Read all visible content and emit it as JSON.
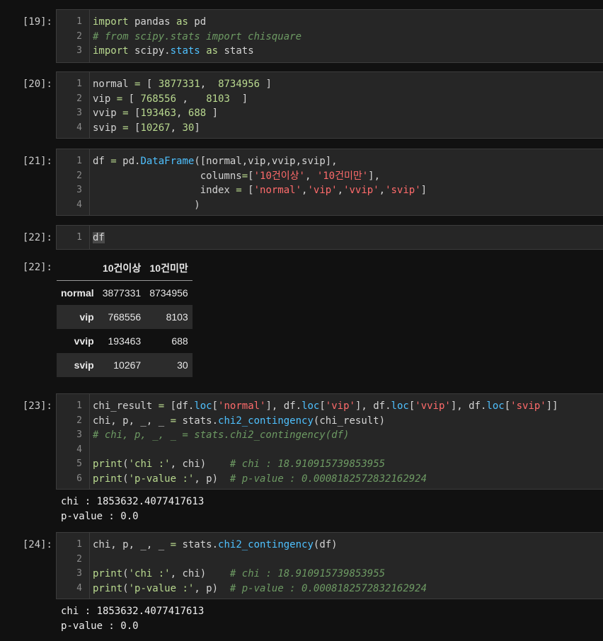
{
  "cells": [
    {
      "prompt": "[19]:",
      "line_numbers": [
        "1",
        "2",
        "3"
      ],
      "lines": [
        [
          {
            "t": "import",
            "c": "kw"
          },
          {
            "t": " pandas ",
            "c": ""
          },
          {
            "t": "as",
            "c": "kw"
          },
          {
            "t": " pd",
            "c": ""
          }
        ],
        [
          {
            "t": "# from scipy.stats import chisquare",
            "c": "cm"
          }
        ],
        [
          {
            "t": "import",
            "c": "kw"
          },
          {
            "t": " scipy.",
            "c": ""
          },
          {
            "t": "stats",
            "c": "fn"
          },
          {
            "t": " ",
            "c": ""
          },
          {
            "t": "as",
            "c": "kw"
          },
          {
            "t": " stats",
            "c": ""
          }
        ]
      ]
    },
    {
      "prompt": "[20]:",
      "line_numbers": [
        "1",
        "2",
        "3",
        "4"
      ],
      "lines": [
        [
          {
            "t": "normal ",
            "c": ""
          },
          {
            "t": "=",
            "c": "num"
          },
          {
            "t": " [ ",
            "c": ""
          },
          {
            "t": "3877331",
            "c": "num"
          },
          {
            "t": ",  ",
            "c": ""
          },
          {
            "t": "8734956",
            "c": "num"
          },
          {
            "t": " ]",
            "c": ""
          }
        ],
        [
          {
            "t": "vip ",
            "c": ""
          },
          {
            "t": "=",
            "c": "num"
          },
          {
            "t": " [ ",
            "c": ""
          },
          {
            "t": "768556",
            "c": "num"
          },
          {
            "t": " ,   ",
            "c": ""
          },
          {
            "t": "8103",
            "c": "num"
          },
          {
            "t": "  ]",
            "c": ""
          }
        ],
        [
          {
            "t": "vvip ",
            "c": ""
          },
          {
            "t": "=",
            "c": "num"
          },
          {
            "t": " [",
            "c": ""
          },
          {
            "t": "193463",
            "c": "num"
          },
          {
            "t": ", ",
            "c": ""
          },
          {
            "t": "688",
            "c": "num"
          },
          {
            "t": " ]",
            "c": ""
          }
        ],
        [
          {
            "t": "svip ",
            "c": ""
          },
          {
            "t": "=",
            "c": "num"
          },
          {
            "t": " [",
            "c": ""
          },
          {
            "t": "10267",
            "c": "num"
          },
          {
            "t": ", ",
            "c": ""
          },
          {
            "t": "30",
            "c": "num"
          },
          {
            "t": "]",
            "c": ""
          }
        ]
      ]
    },
    {
      "prompt": "[21]:",
      "line_numbers": [
        "1",
        "2",
        "3",
        "4"
      ],
      "lines": [
        [
          {
            "t": "df ",
            "c": ""
          },
          {
            "t": "=",
            "c": "num"
          },
          {
            "t": " pd.",
            "c": ""
          },
          {
            "t": "DataFrame",
            "c": "fn"
          },
          {
            "t": "([normal,vip,vvip,svip],",
            "c": ""
          }
        ],
        [
          {
            "t": "                  columns",
            "c": ""
          },
          {
            "t": "=",
            "c": "num"
          },
          {
            "t": "[",
            "c": ""
          },
          {
            "t": "'10건이상'",
            "c": "str"
          },
          {
            "t": ", ",
            "c": ""
          },
          {
            "t": "'10건미만'",
            "c": "str"
          },
          {
            "t": "],",
            "c": ""
          }
        ],
        [
          {
            "t": "                  index ",
            "c": ""
          },
          {
            "t": "=",
            "c": "num"
          },
          {
            "t": " [",
            "c": ""
          },
          {
            "t": "'normal'",
            "c": "str"
          },
          {
            "t": ",",
            "c": ""
          },
          {
            "t": "'vip'",
            "c": "str"
          },
          {
            "t": ",",
            "c": ""
          },
          {
            "t": "'vvip'",
            "c": "str"
          },
          {
            "t": ",",
            "c": ""
          },
          {
            "t": "'svip'",
            "c": "str"
          },
          {
            "t": "]",
            "c": ""
          }
        ],
        [
          {
            "t": "                 )",
            "c": ""
          }
        ]
      ]
    },
    {
      "prompt": "[22]:",
      "line_numbers": [
        "1"
      ],
      "lines": [
        [
          {
            "t": "df",
            "c": "hl"
          }
        ]
      ]
    },
    {
      "prompt": "[23]:",
      "line_numbers": [
        "1",
        "2",
        "3",
        "4",
        "5",
        "6"
      ],
      "lines": [
        [
          {
            "t": "chi_result ",
            "c": ""
          },
          {
            "t": "=",
            "c": "num"
          },
          {
            "t": " [df.",
            "c": ""
          },
          {
            "t": "loc",
            "c": "fn"
          },
          {
            "t": "[",
            "c": ""
          },
          {
            "t": "'normal'",
            "c": "str"
          },
          {
            "t": "], df.",
            "c": ""
          },
          {
            "t": "loc",
            "c": "fn"
          },
          {
            "t": "[",
            "c": ""
          },
          {
            "t": "'vip'",
            "c": "str"
          },
          {
            "t": "], df.",
            "c": ""
          },
          {
            "t": "loc",
            "c": "fn"
          },
          {
            "t": "[",
            "c": ""
          },
          {
            "t": "'vvip'",
            "c": "str"
          },
          {
            "t": "], df.",
            "c": ""
          },
          {
            "t": "loc",
            "c": "fn"
          },
          {
            "t": "[",
            "c": ""
          },
          {
            "t": "'svip'",
            "c": "str"
          },
          {
            "t": "]]",
            "c": ""
          }
        ],
        [
          {
            "t": "chi, p, _, _ ",
            "c": ""
          },
          {
            "t": "=",
            "c": "num"
          },
          {
            "t": " stats.",
            "c": ""
          },
          {
            "t": "chi2_contingency",
            "c": "fn"
          },
          {
            "t": "(chi_result)",
            "c": ""
          }
        ],
        [
          {
            "t": "# chi, p, _, _ = stats.chi2_contingency(df)",
            "c": "cm"
          }
        ],
        [
          {
            "t": "",
            "c": ""
          }
        ],
        [
          {
            "t": "print",
            "c": "kw"
          },
          {
            "t": "(",
            "c": ""
          },
          {
            "t": "'chi :'",
            "c": "kw"
          },
          {
            "t": ", chi)    ",
            "c": ""
          },
          {
            "t": "# chi : 18.910915739853955",
            "c": "cm"
          }
        ],
        [
          {
            "t": "print",
            "c": "kw"
          },
          {
            "t": "(",
            "c": ""
          },
          {
            "t": "'p-value :'",
            "c": "kw"
          },
          {
            "t": ", p)  ",
            "c": ""
          },
          {
            "t": "# p-value : 0.0008182572832162924",
            "c": "cm"
          }
        ]
      ]
    },
    {
      "prompt": "[24]:",
      "line_numbers": [
        "1",
        "2",
        "3",
        "4"
      ],
      "lines": [
        [
          {
            "t": "chi, p, _, _ ",
            "c": ""
          },
          {
            "t": "=",
            "c": "num"
          },
          {
            "t": " stats.",
            "c": ""
          },
          {
            "t": "chi2_contingency",
            "c": "fn"
          },
          {
            "t": "(df)",
            "c": ""
          }
        ],
        [
          {
            "t": "",
            "c": ""
          }
        ],
        [
          {
            "t": "print",
            "c": "kw"
          },
          {
            "t": "(",
            "c": ""
          },
          {
            "t": "'chi :'",
            "c": "kw"
          },
          {
            "t": ", chi)    ",
            "c": ""
          },
          {
            "t": "# chi : 18.910915739853955",
            "c": "cm"
          }
        ],
        [
          {
            "t": "print",
            "c": "kw"
          },
          {
            "t": "(",
            "c": ""
          },
          {
            "t": "'p-value :'",
            "c": "kw"
          },
          {
            "t": ", p)  ",
            "c": ""
          },
          {
            "t": "# p-value : 0.0008182572832162924",
            "c": "cm"
          }
        ]
      ]
    }
  ],
  "out22": {
    "prompt": "[22]:",
    "columns": [
      "10건이상",
      "10건미만"
    ],
    "rows": [
      {
        "index": "normal",
        "values": [
          "3877331",
          "8734956"
        ]
      },
      {
        "index": "vip",
        "values": [
          "768556",
          "8103"
        ]
      },
      {
        "index": "vvip",
        "values": [
          "193463",
          "688"
        ]
      },
      {
        "index": "svip",
        "values": [
          "10267",
          "30"
        ]
      }
    ]
  },
  "out23": {
    "line1": "chi : 1853632.4077417613",
    "line2": "p-value : 0.0"
  },
  "out24": {
    "line1": "chi : 1853632.4077417613",
    "line2": "p-value : 0.0"
  },
  "colors": {
    "background": "#111111",
    "cell": "#262626",
    "keyword": "#b9d98f",
    "string": "#ff6b6b",
    "comment": "#6d9a63",
    "function": "#4fc1ff"
  }
}
